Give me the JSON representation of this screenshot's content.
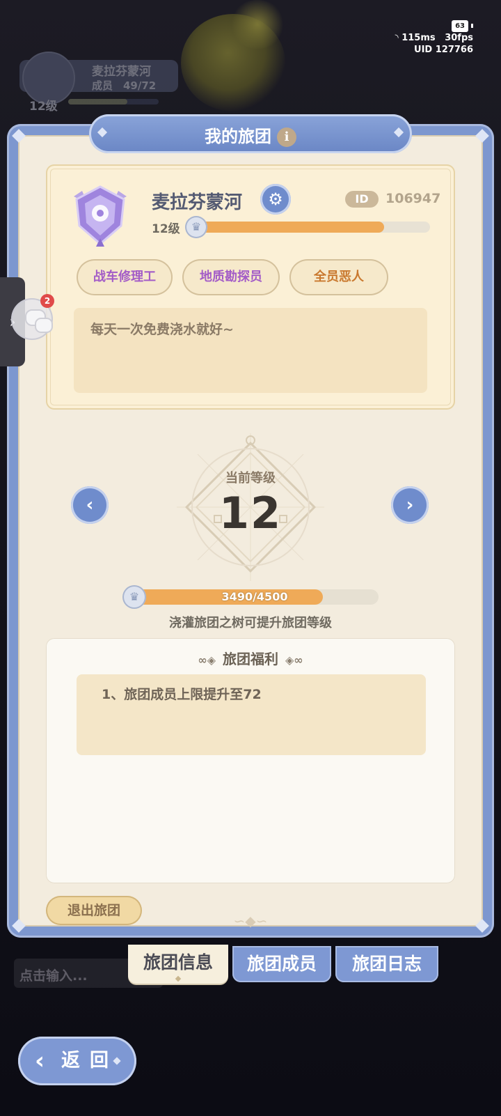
{
  "status_bar": {
    "battery": "63",
    "network": "115ms",
    "fps": "30fps",
    "uid": "UID 127766"
  },
  "top_chip": {
    "name": "麦拉芬蒙河",
    "members": "成员　49/72",
    "level": "12级"
  },
  "panel": {
    "title": "我的旅团",
    "info_icon": "i"
  },
  "guild": {
    "name": "麦拉芬蒙河",
    "id_label": "ID",
    "id_value": "106947",
    "level_label": "12级",
    "level_progress": 0.8,
    "tags": [
      "战车修理工",
      "地质勘探员",
      "全员恶人"
    ],
    "motto": "每天一次免费浇水就好~"
  },
  "level_section": {
    "current_label": "当前等级",
    "current_level": "12",
    "xp_text": "3490/4500",
    "xp_current": 3490,
    "xp_max": 4500,
    "hint": "浇灌旅团之树可提升旅团等级"
  },
  "benefits": {
    "title": "旅团福利",
    "items": [
      "1、旅团成员上限提升至72"
    ]
  },
  "leave_button": "退出旅团",
  "tabs": [
    {
      "label": "旅团信息",
      "active": true
    },
    {
      "label": "旅团成员",
      "active": false
    },
    {
      "label": "旅团日志",
      "active": false
    }
  ],
  "chat": {
    "placeholder": "点击输入...",
    "badge_count": "2"
  },
  "back_button": {
    "label": "返回",
    "arrow": "‹"
  },
  "colors": {
    "accent_blue": "#7e98d3",
    "panel_bg": "#f3ecde",
    "progress_orange": "#efaa58",
    "tag_purple": "#a35cc7",
    "tag_orange": "#c9782e"
  },
  "icons": [
    "info-icon",
    "gear-icon",
    "crown-icon",
    "prev-arrow-icon",
    "next-arrow-icon",
    "chat-icon",
    "chevron-right-icon",
    "back-arrow-icon",
    "wifi-icon",
    "battery-icon"
  ]
}
